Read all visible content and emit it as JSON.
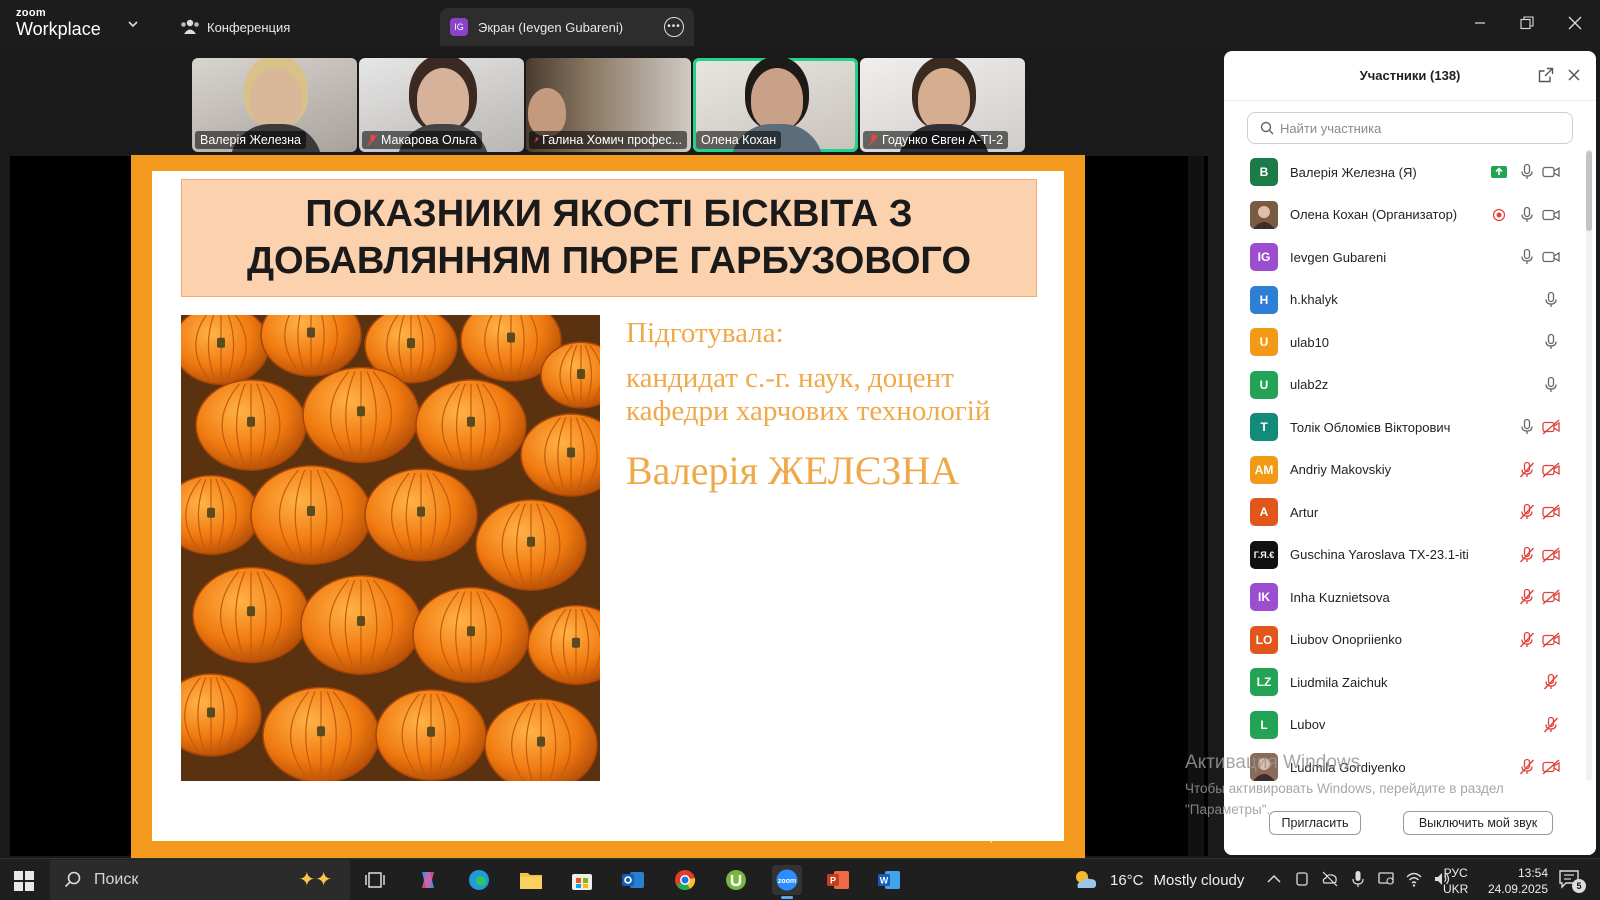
{
  "app": {
    "brand": "zoom",
    "product": "Workplace",
    "tabs": [
      {
        "label": "Конференция",
        "icon": "people-icon"
      },
      {
        "label": "Экран (Ievgen Gubareni)",
        "badge": "IG"
      }
    ]
  },
  "video_strip": [
    {
      "name": "Валерія Железна",
      "muted": false
    },
    {
      "name": "Макарова Ольга",
      "muted": true
    },
    {
      "name": "Галина Хомич профес...",
      "muted": true
    },
    {
      "name": "Олена Кохан",
      "muted": false,
      "active": true
    },
    {
      "name": "Годунко Євген А-ТІ-2",
      "muted": true
    }
  ],
  "slide": {
    "title": "ПОКАЗНИКИ ЯКОСТІ БІСКВІТА З ДОБАВЛЯННЯМ ПЮРЕ ГАРБУЗОВОГО",
    "prepared": "Підготувала:",
    "degree": "кандидат с.-г. наук, доцент кафедри харчових технологій",
    "author": "Валерія ЖЕЛЄЗНА",
    "watermark": "Активация Win"
  },
  "participants": {
    "title": "Участники (138)",
    "search_placeholder": "Найти участника",
    "list": [
      {
        "name": "Валерія Железна (Я)",
        "initials": "B",
        "color": "#1f7a4a",
        "mic": "on",
        "cam": "on",
        "share": true
      },
      {
        "name": "Олена Кохан (Организатор)",
        "initials": "",
        "color": "#7a5a40",
        "mic": "on",
        "cam": "on",
        "record": true
      },
      {
        "name": "Ievgen Gubareni",
        "initials": "IG",
        "color": "#9b4fd0",
        "mic": "on",
        "cam": "on"
      },
      {
        "name": "h.khalyk",
        "initials": "H",
        "color": "#2d7fd6",
        "mic": "on",
        "cam": "none"
      },
      {
        "name": "ulab10",
        "initials": "U",
        "color": "#f29a16",
        "mic": "on",
        "cam": "none"
      },
      {
        "name": "ulab2z",
        "initials": "U",
        "color": "#23a455",
        "mic": "on",
        "cam": "none"
      },
      {
        "name": "Толік Обломієв Вікторович",
        "initials": "T",
        "color": "#148a7a",
        "mic": "on",
        "cam": "off"
      },
      {
        "name": "Andriy Makovskiy",
        "initials": "AM",
        "color": "#f29a16",
        "mic": "off",
        "cam": "off"
      },
      {
        "name": "Artur",
        "initials": "A",
        "color": "#e0561b",
        "mic": "off",
        "cam": "off"
      },
      {
        "name": "Guschina Yaroslava ТХ-23.1-iti",
        "initials": "Г.Я.€",
        "color": "#111111",
        "mic": "off",
        "cam": "off"
      },
      {
        "name": "Inha Kuznietsova",
        "initials": "IK",
        "color": "#9b4fd0",
        "mic": "off",
        "cam": "off"
      },
      {
        "name": "Liubov Onopriienko",
        "initials": "LO",
        "color": "#e0561b",
        "mic": "off",
        "cam": "off"
      },
      {
        "name": "Liudmila Zaichuk",
        "initials": "LZ",
        "color": "#23a455",
        "mic": "off",
        "cam": "none"
      },
      {
        "name": "Lubov",
        "initials": "L",
        "color": "#23a455",
        "mic": "off",
        "cam": "none"
      },
      {
        "name": "Ludmila Gordiyenko",
        "initials": "",
        "color": "#8a6a5a",
        "mic": "off",
        "cam": "off"
      }
    ],
    "invite_label": "Пригласить",
    "mute_me_label": "Выключить мой звук"
  },
  "activation": {
    "line1": "Активация Windows",
    "line2": "Чтобы активировать Windows, перейдите в раздел \"Параметры\"."
  },
  "taskbar": {
    "search_label": "Поиск",
    "weather_temp": "16°C",
    "weather_text": "Mostly cloudy",
    "lang_top": "РУС",
    "lang_bottom": "UKR",
    "time": "13:54",
    "date": "24.09.2025",
    "notif_count": "5"
  }
}
